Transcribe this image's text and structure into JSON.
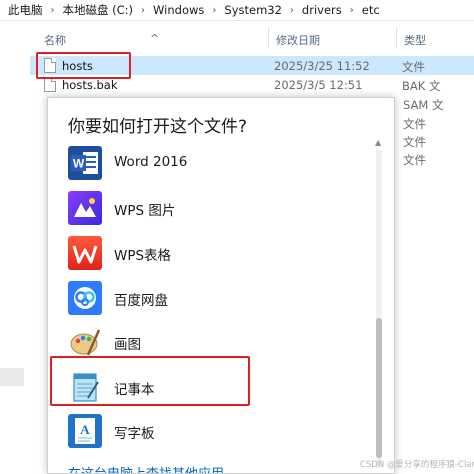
{
  "breadcrumb": [
    "此电脑",
    "本地磁盘 (C:)",
    "Windows",
    "System32",
    "drivers",
    "etc"
  ],
  "columns": {
    "name": "名称",
    "date": "修改日期",
    "type": "类型"
  },
  "files": [
    {
      "name": "hosts",
      "date": "2025/3/25 11:52",
      "type": "文件"
    },
    {
      "name": "hosts.bak",
      "date": "2025/3/5 12:51",
      "type": "BAK 文"
    }
  ],
  "background_types": [
    "SAM 文",
    "文件",
    "文件",
    "文件"
  ],
  "dialog": {
    "title": "你要如何打开这个文件?",
    "apps": [
      {
        "label": "Word 2016",
        "icon": "word-icon"
      },
      {
        "label": "WPS 图片",
        "icon": "wps-image-icon"
      },
      {
        "label": "WPS表格",
        "icon": "wps-sheet-icon"
      },
      {
        "label": "百度网盘",
        "icon": "baidu-netdisk-icon"
      },
      {
        "label": "画图",
        "icon": "paint-icon"
      },
      {
        "label": "记事本",
        "icon": "notepad-icon"
      },
      {
        "label": "写字板",
        "icon": "wordpad-icon"
      }
    ],
    "more_link": "在这台电脑上查找其他应用"
  },
  "watermark": "CSDN @爱分享的程序猿-Clare",
  "colors": {
    "selection": "#cce8ff",
    "highlight": "#e02020",
    "link": "#0067c0"
  }
}
